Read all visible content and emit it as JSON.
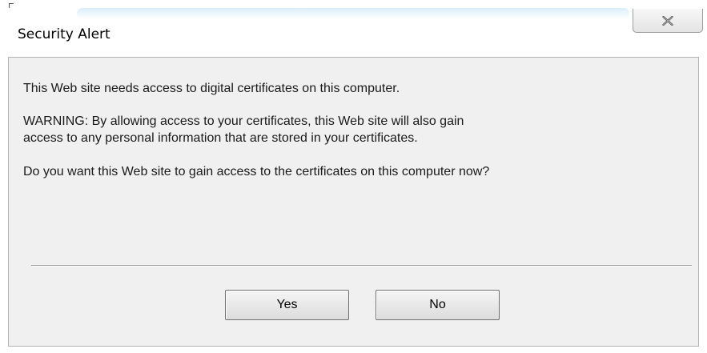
{
  "window": {
    "title": "Security Alert",
    "close_icon": "close-icon"
  },
  "message": {
    "line1": "This Web site needs access to digital certificates on this computer.",
    "warning_line1": "WARNING: By allowing access to your certificates, this Web site will also gain",
    "warning_line2": "access to any personal information that are stored in your certificates.",
    "question": "Do you want this Web site to gain access to the certificates on this computer now?"
  },
  "buttons": {
    "yes_label": "Yes",
    "no_label": "No"
  },
  "colors": {
    "client_background": "#f0f0f0",
    "window_background": "#ffffff",
    "border": "#b4b4b4"
  }
}
